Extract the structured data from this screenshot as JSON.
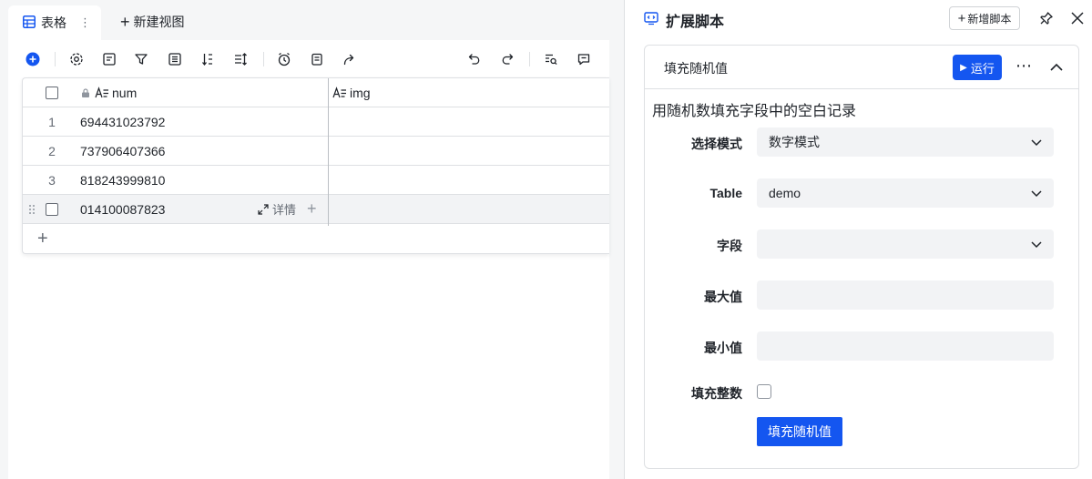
{
  "colors": {
    "accent": "#1456f0",
    "border": "#dee0e3",
    "text": "#1f2329",
    "muted": "#646a73"
  },
  "tabs": {
    "active_label": "表格",
    "new_view_label": "新建视图"
  },
  "toolbar": {
    "icons": [
      "add-icon",
      "settings-icon",
      "form-icon",
      "filter-icon",
      "group-icon",
      "sort-icon",
      "row-height-icon",
      "reminder-icon",
      "copy-icon",
      "share-icon",
      "undo-icon",
      "redo-icon",
      "search-icon",
      "comment-icon"
    ]
  },
  "table": {
    "columns": [
      {
        "name": "num",
        "locked": true
      },
      {
        "name": "img",
        "locked": false
      }
    ],
    "rows": [
      {
        "index": "1",
        "num": "694431023792"
      },
      {
        "index": "2",
        "num": "737906407366"
      },
      {
        "index": "3",
        "num": "818243999810"
      },
      {
        "index": "",
        "num": "014100087823",
        "hovered": true,
        "detail_label": "详情"
      }
    ]
  },
  "panel": {
    "title": "扩展脚本",
    "add_script_label": "新增脚本",
    "card": {
      "title": "填充随机值",
      "run_label": "运行",
      "description": "用随机数填充字段中的空白记录",
      "fields": [
        {
          "label": "选择模式",
          "value": "数字模式",
          "type": "select"
        },
        {
          "label": "Table",
          "value": "demo",
          "type": "select"
        },
        {
          "label": "字段",
          "value": "",
          "type": "select"
        },
        {
          "label": "最大值",
          "value": "",
          "type": "input"
        },
        {
          "label": "最小值",
          "value": "",
          "type": "input"
        }
      ],
      "checkbox_label": "填充整数",
      "submit_label": "填充随机值"
    }
  }
}
